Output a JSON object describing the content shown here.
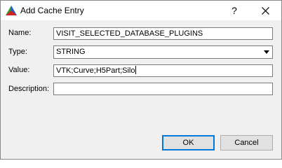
{
  "window": {
    "title": "Add Cache Entry",
    "help_glyph": "?"
  },
  "form": {
    "name_label": "Name:",
    "name_value": "VISIT_SELECTED_DATABASE_PLUGINS",
    "type_label": "Type:",
    "type_value": "STRING",
    "value_label": "Value:",
    "value_value": "VTK;Curve;H5Part;Silo",
    "description_label": "Description:",
    "description_value": ""
  },
  "buttons": {
    "ok_label": "OK",
    "cancel_label": "Cancel"
  },
  "icons": {
    "app": "visit-triangle-icon",
    "help": "help-icon",
    "close": "close-icon",
    "dropdown": "chevron-down-icon"
  }
}
